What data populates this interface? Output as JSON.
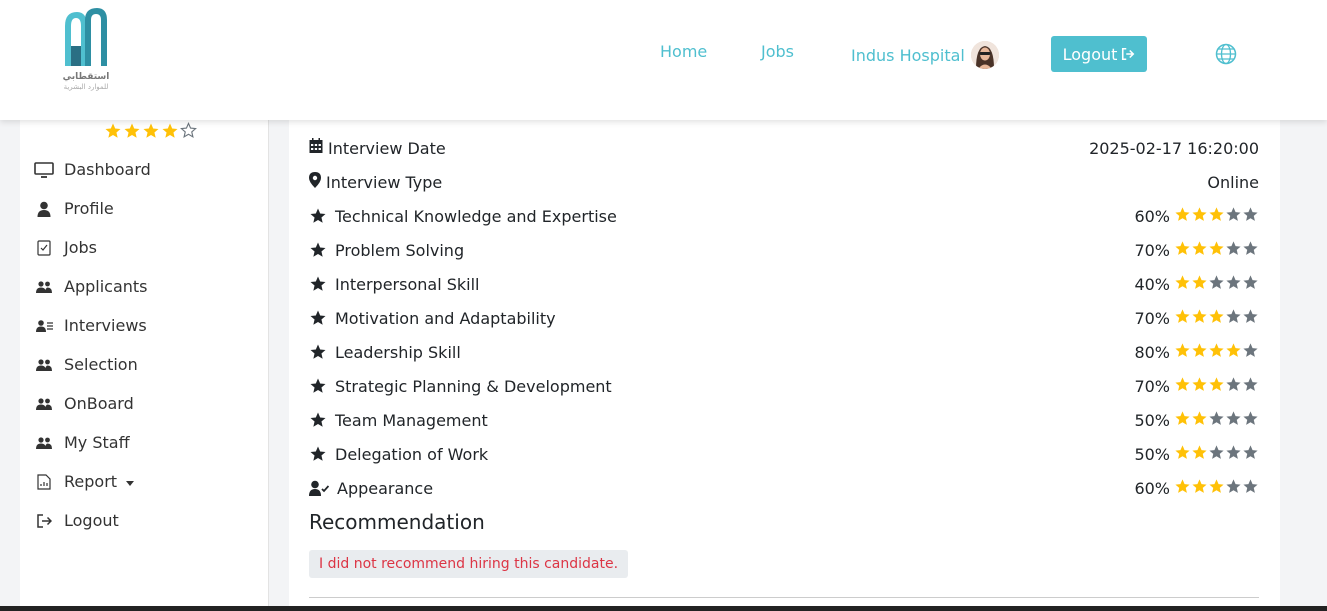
{
  "brand": {
    "line1": "استقطابي",
    "line2": "للموارد البشرية"
  },
  "nav": {
    "home": "Home",
    "jobs": "Jobs",
    "user": "Indus Hospital",
    "logout": "Logout"
  },
  "sidebar": {
    "rating": 4,
    "items": [
      {
        "label": "Dashboard",
        "icon": "monitor-icon"
      },
      {
        "label": "Profile",
        "icon": "user-icon"
      },
      {
        "label": "Jobs",
        "icon": "checklist-icon"
      },
      {
        "label": "Applicants",
        "icon": "users-icon"
      },
      {
        "label": "Interviews",
        "icon": "user-list-icon"
      },
      {
        "label": "Selection",
        "icon": "users-icon"
      },
      {
        "label": "OnBoard",
        "icon": "users-icon"
      },
      {
        "label": "My Staff",
        "icon": "users-icon"
      },
      {
        "label": "Report",
        "icon": "report-icon"
      },
      {
        "label": "Logout",
        "icon": "logout-icon"
      }
    ]
  },
  "details": [
    {
      "label": "Interview Date",
      "value": "2025-02-17 16:20:00",
      "icon": "calendar-icon"
    },
    {
      "label": "Interview Type",
      "value": "Online",
      "icon": "map-marker-icon"
    }
  ],
  "ratings": [
    {
      "label": "Technical Knowledge and Expertise",
      "percent": "60%",
      "stars": 3
    },
    {
      "label": "Problem Solving",
      "percent": "70%",
      "stars": 3
    },
    {
      "label": "Interpersonal Skill",
      "percent": "40%",
      "stars": 2
    },
    {
      "label": "Motivation and Adaptability",
      "percent": "70%",
      "stars": 3
    },
    {
      "label": "Leadership Skill",
      "percent": "80%",
      "stars": 4
    },
    {
      "label": "Strategic Planning & Development",
      "percent": "70%",
      "stars": 3
    },
    {
      "label": "Team Management",
      "percent": "50%",
      "stars": 2
    },
    {
      "label": "Delegation of Work",
      "percent": "50%",
      "stars": 2
    },
    {
      "label": "Appearance",
      "percent": "60%",
      "stars": 3
    }
  ],
  "recommendation": {
    "title": "Recommendation",
    "text": "I did not recommend hiring this candidate."
  },
  "colors": {
    "accent": "#4fbfcf",
    "star_on": "#ffc107",
    "star_off": "#6c757d",
    "danger": "#dc3545"
  }
}
